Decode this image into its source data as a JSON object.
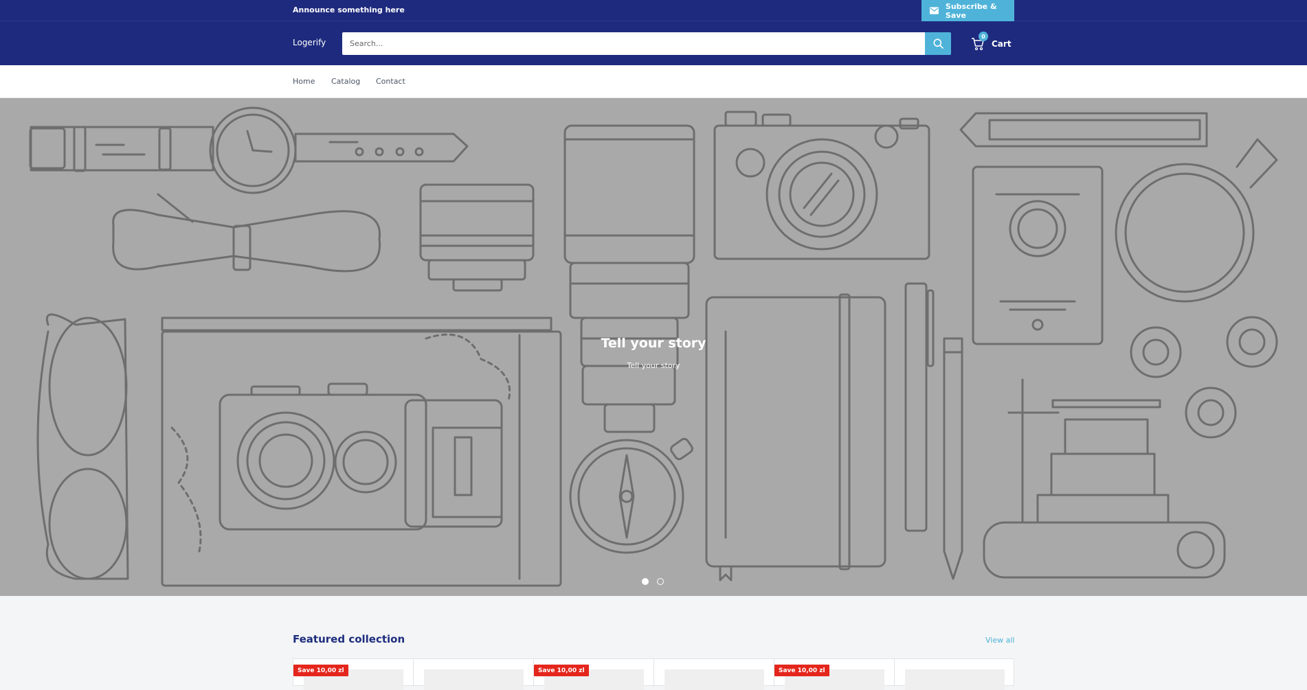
{
  "announcement": {
    "text": "Announce something here"
  },
  "subscribe": {
    "label": "Subscribe & Save",
    "icon": "envelope-icon"
  },
  "header": {
    "logo": "Logerify",
    "search": {
      "placeholder": "Search...",
      "value": ""
    },
    "cart": {
      "label": "Cart",
      "count": "0"
    }
  },
  "nav": {
    "items": [
      {
        "label": "Home"
      },
      {
        "label": "Catalog"
      },
      {
        "label": "Contact"
      }
    ]
  },
  "hero": {
    "title": "Tell your story",
    "subtitle": "Tell your story",
    "slides": 2,
    "active_slide": 1
  },
  "featured": {
    "title": "Featured collection",
    "view_all": "View all",
    "badges": [
      {
        "label": "Save 10,00 zl"
      },
      {
        "label": "Save 10,00 zl"
      },
      {
        "label": "Save 10,00 zl"
      }
    ]
  },
  "colors": {
    "primary": "#1e2a7e",
    "accent": "#4fb3d9",
    "badge": "#e4261c",
    "hero_bg": "#a9a9a9"
  }
}
